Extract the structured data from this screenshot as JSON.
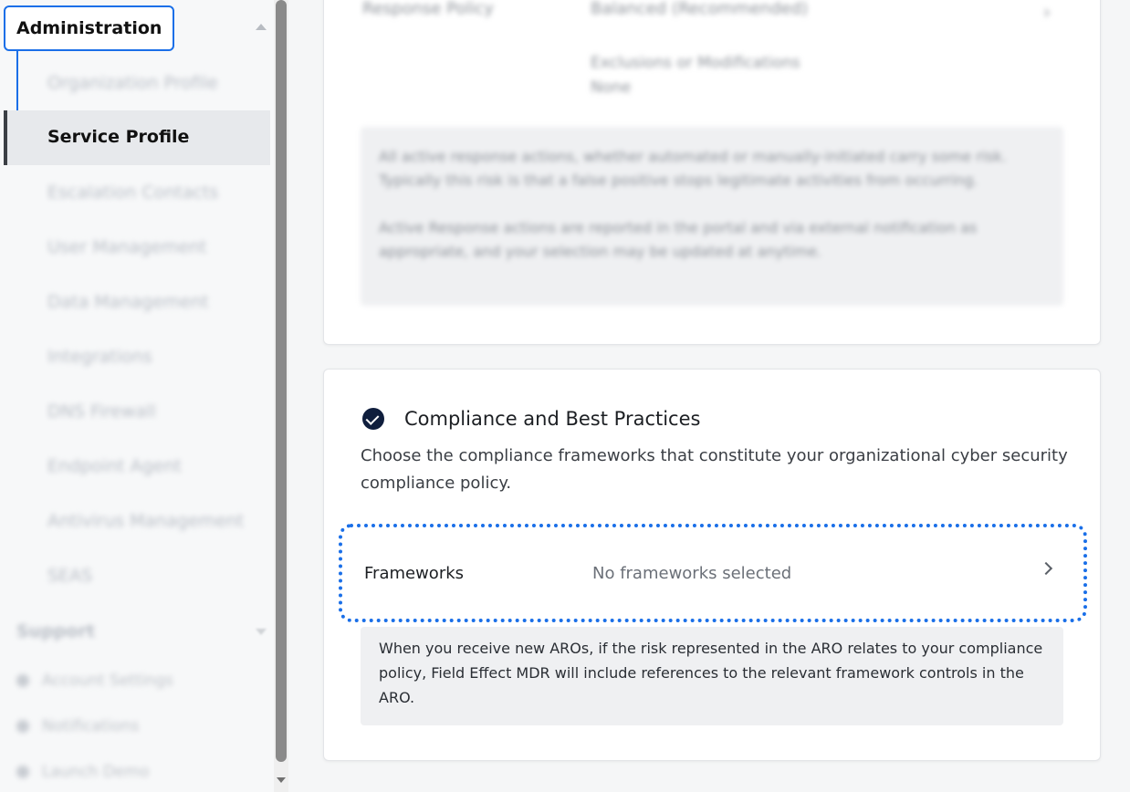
{
  "sidebar": {
    "section_title": "Administration",
    "items": [
      {
        "label": "Organization Profile"
      },
      {
        "label": "Service Profile"
      },
      {
        "label": "Escalation Contacts"
      },
      {
        "label": "User Management"
      },
      {
        "label": "Data Management"
      },
      {
        "label": "Integrations"
      },
      {
        "label": "DNS Firewall"
      },
      {
        "label": "Endpoint Agent"
      },
      {
        "label": "Antivirus Management"
      },
      {
        "label": "SEAS"
      }
    ],
    "support_title": "Support",
    "support_items": [
      {
        "label": "Account Settings",
        "icon": "user-icon"
      },
      {
        "label": "Notifications",
        "icon": "bell-icon"
      },
      {
        "label": "Launch Demo",
        "icon": "play-icon"
      }
    ]
  },
  "response": {
    "label": "Response Policy",
    "value": "Balanced (Recommended)",
    "exclusions_label": "Exclusions or Modifications",
    "exclusions_value": "None",
    "info_p1": "All active response actions, whether automated or manually-initiated carry some risk. Typically this risk is that a false positive stops legitimate activities from occurring.",
    "info_p2": "Active Response actions are reported in the portal and via external notification as appropriate, and your selection may be updated at anytime."
  },
  "compliance": {
    "title": "Compliance and Best Practices",
    "description": "Choose the compliance frameworks that constitute your organizational cyber security compliance policy.",
    "frameworks_label": "Frameworks",
    "frameworks_value": "No frameworks selected",
    "info": "When you receive new AROs, if the risk represented in the ARO relates to your compliance policy, Field Effect MDR will include references to the relevant framework controls in the ARO."
  },
  "colors": {
    "accent": "#1a6fe8",
    "check": "#0f1e3d"
  }
}
